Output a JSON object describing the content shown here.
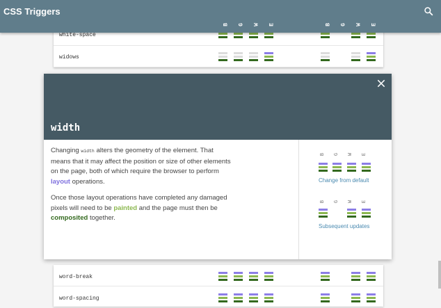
{
  "app": {
    "title": "CSS Triggers"
  },
  "columns": [
    "B",
    "G",
    "W",
    "E"
  ],
  "rows_above": [
    {
      "name": "white-space"
    },
    {
      "name": "widows"
    }
  ],
  "rows_below": [
    {
      "name": "word-break"
    },
    {
      "name": "word-spacing"
    }
  ],
  "card": {
    "property": "width",
    "p1_a": "Changing ",
    "p1_code": "width",
    "p1_b": " alters the geometry of the element. That means that it may affect the position or size of other elements on the page, both of which require the browser to perform ",
    "p1_kw": "layout",
    "p1_c": " operations.",
    "p2_a": "Once those layout operations have completed any damaged pixels will need to be ",
    "p2_kw1": "painted",
    "p2_b": " and the page must then be ",
    "p2_kw2": "composited",
    "p2_c": " together.",
    "change_caption": "Change from default",
    "subsequent_caption": "Subsequent updates"
  },
  "colors": {
    "layout": "#8c7ee6",
    "paint": "#8cb850",
    "composite": "#33691e",
    "faded": "#dcdcdc",
    "header": "#607d8b",
    "card_header": "#455a64"
  },
  "icons": {
    "search": "search-icon",
    "close": "close-icon"
  }
}
